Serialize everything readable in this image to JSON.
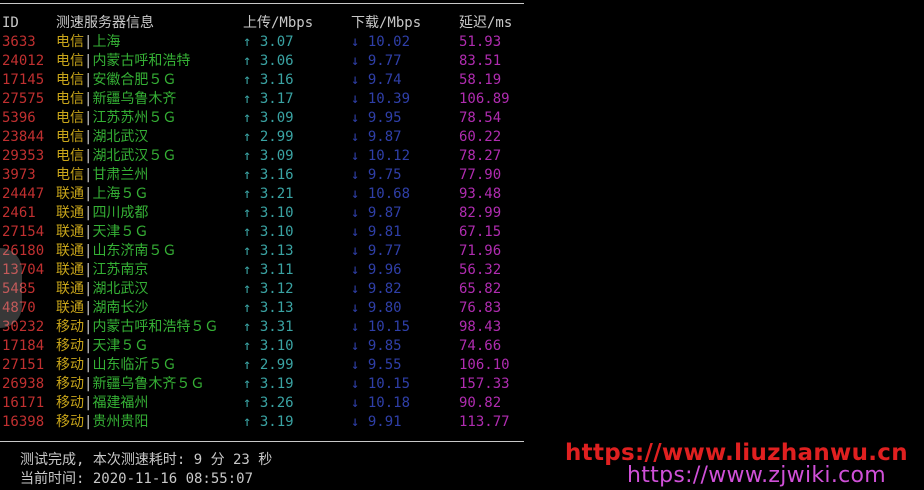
{
  "header": {
    "id": "ID",
    "server": "测速服务器信息",
    "upload": "上传/Mbps",
    "download": "下载/Mbps",
    "latency": "延迟/ms"
  },
  "up_arrow": "↑",
  "down_arrow": "↓",
  "rows": [
    {
      "id": "3633",
      "isp": "电信",
      "city": "上海",
      "up": "3.07",
      "down": "10.02",
      "latency": "51.93"
    },
    {
      "id": "24012",
      "isp": "电信",
      "city": "内蒙古呼和浩特",
      "up": "3.06",
      "down": "9.77",
      "latency": "83.51"
    },
    {
      "id": "17145",
      "isp": "电信",
      "city": "安徽合肥５Ｇ",
      "up": "3.16",
      "down": "9.74",
      "latency": "58.19"
    },
    {
      "id": "27575",
      "isp": "电信",
      "city": "新疆乌鲁木齐",
      "up": "3.17",
      "down": "10.39",
      "latency": "106.89"
    },
    {
      "id": "5396",
      "isp": "电信",
      "city": "江苏苏州５Ｇ",
      "up": "3.09",
      "down": "9.95",
      "latency": "78.54"
    },
    {
      "id": "23844",
      "isp": "电信",
      "city": "湖北武汉",
      "up": "2.99",
      "down": "9.87",
      "latency": "60.22"
    },
    {
      "id": "29353",
      "isp": "电信",
      "city": "湖北武汉５Ｇ",
      "up": "3.09",
      "down": "10.12",
      "latency": "78.27"
    },
    {
      "id": "3973",
      "isp": "电信",
      "city": "甘肃兰州",
      "up": "3.16",
      "down": "9.75",
      "latency": "77.90"
    },
    {
      "id": "24447",
      "isp": "联通",
      "city": "上海５Ｇ",
      "up": "3.21",
      "down": "10.68",
      "latency": "93.48"
    },
    {
      "id": "2461",
      "isp": "联通",
      "city": "四川成都",
      "up": "3.10",
      "down": "9.87",
      "latency": "82.99"
    },
    {
      "id": "27154",
      "isp": "联通",
      "city": "天津５Ｇ",
      "up": "3.10",
      "down": "9.81",
      "latency": "67.15"
    },
    {
      "id": "26180",
      "isp": "联通",
      "city": "山东济南５Ｇ",
      "up": "3.13",
      "down": "9.77",
      "latency": "71.96"
    },
    {
      "id": "13704",
      "isp": "联通",
      "city": "江苏南京",
      "up": "3.11",
      "down": "9.96",
      "latency": "56.32"
    },
    {
      "id": "5485",
      "isp": "联通",
      "city": "湖北武汉",
      "up": "3.12",
      "down": "9.82",
      "latency": "65.82"
    },
    {
      "id": "4870",
      "isp": "联通",
      "city": "湖南长沙",
      "up": "3.13",
      "down": "9.80",
      "latency": "76.83"
    },
    {
      "id": "30232",
      "isp": "移动",
      "city": "内蒙古呼和浩特５Ｇ",
      "up": "3.31",
      "down": "10.15",
      "latency": "98.43"
    },
    {
      "id": "17184",
      "isp": "移动",
      "city": "天津５Ｇ",
      "up": "3.10",
      "down": "9.85",
      "latency": "74.66"
    },
    {
      "id": "27151",
      "isp": "移动",
      "city": "山东临沂５Ｇ",
      "up": "2.99",
      "down": "9.55",
      "latency": "106.10"
    },
    {
      "id": "26938",
      "isp": "移动",
      "city": "新疆乌鲁木齐５Ｇ",
      "up": "3.19",
      "down": "10.15",
      "latency": "157.33"
    },
    {
      "id": "16171",
      "isp": "移动",
      "city": "福建福州",
      "up": "3.26",
      "down": "10.18",
      "latency": "90.82"
    },
    {
      "id": "16398",
      "isp": "移动",
      "city": "贵州贵阳",
      "up": "3.19",
      "down": "9.91",
      "latency": "113.77"
    }
  ],
  "footer": {
    "completed": "测试完成, 本次测速耗时: 9 分 23 秒",
    "current_time": "当前时间: 2020-11-16 08:55:07"
  },
  "watermarks": {
    "line1": "https://www.liuzhanwu.cn",
    "line2": "https://www.zjwiki.com"
  },
  "colors": {
    "id": "#c03030",
    "isp": "#c8a51a",
    "city": "#35b035",
    "upload": "#3aa3a3",
    "download": "#2f3fa8",
    "latency": "#b02cb0",
    "watermark1": "#e02020",
    "watermark2": "#d050d8"
  }
}
